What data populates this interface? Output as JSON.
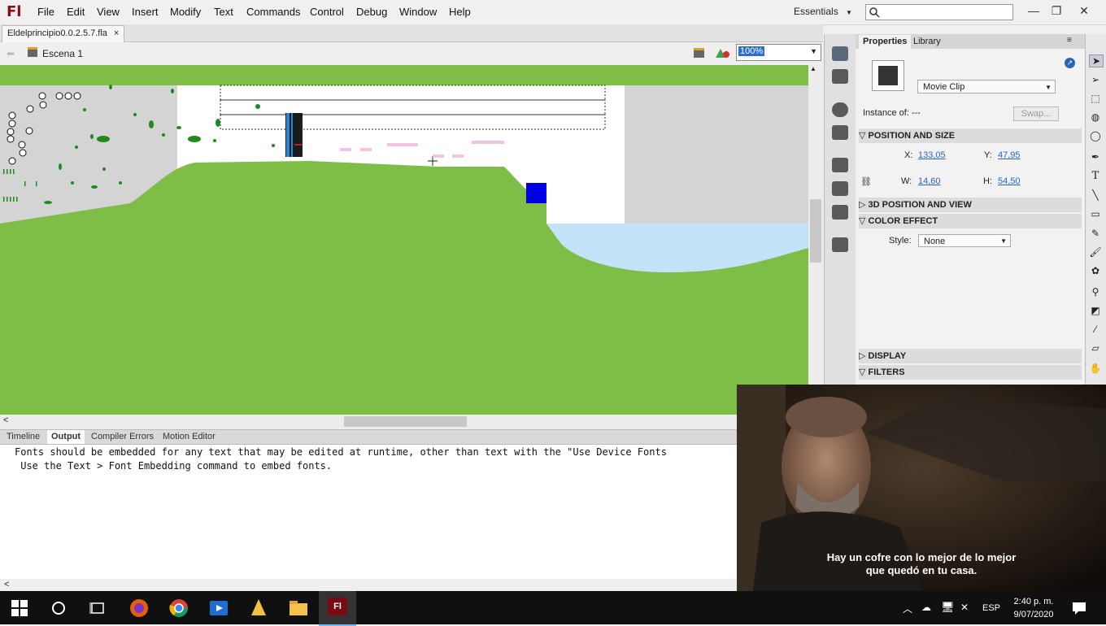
{
  "app": {
    "logo": "Fl",
    "menus": [
      "File",
      "Edit",
      "View",
      "Insert",
      "Modify",
      "Text",
      "Commands",
      "Control",
      "Debug",
      "Window",
      "Help"
    ],
    "workspace": "Essentials",
    "search_placeholder": ""
  },
  "document": {
    "tab_title": "Eldelprincipio0.0.2.5.7.fla",
    "scene": "Escena 1",
    "zoom": "100%"
  },
  "bottom_panel": {
    "tabs": [
      "Timeline",
      "Output",
      "Compiler Errors",
      "Motion Editor"
    ],
    "active_tab": "Output",
    "output_lines": [
      "Fonts should be embedded for any text that may be edited at runtime, other than text with the \"Use Device Fonts",
      " Use the Text > Font Embedding command to embed fonts."
    ]
  },
  "properties": {
    "tabs": [
      "Properties",
      "Library"
    ],
    "symbol_type": "Movie Clip",
    "instance_of_label": "Instance of:",
    "instance_of_value": "---",
    "swap_label": "Swap...",
    "position_size_header": "POSITION AND SIZE",
    "x_label": "X:",
    "x": "133,05",
    "y_label": "Y:",
    "y": "47,95",
    "w_label": "W:",
    "w": "14,60",
    "h_label": "H:",
    "h": "54,50",
    "section_3d": "3D POSITION AND VIEW",
    "section_color": "COLOR EFFECT",
    "style_label": "Style:",
    "style_value": "None",
    "section_display": "DISPLAY",
    "section_filters": "FILTERS"
  },
  "video": {
    "subtitle_line1": "Hay un cofre con lo mejor de lo mejor",
    "subtitle_line2": "que quedó en tu casa."
  },
  "taskbar": {
    "language": "ESP",
    "time": "2:40 p. m.",
    "date": "9/07/2020"
  },
  "colors": {
    "stage_green": "#7ebd46",
    "flash_red": "#8b0a14",
    "selection_blue": "#2c6fc9"
  }
}
